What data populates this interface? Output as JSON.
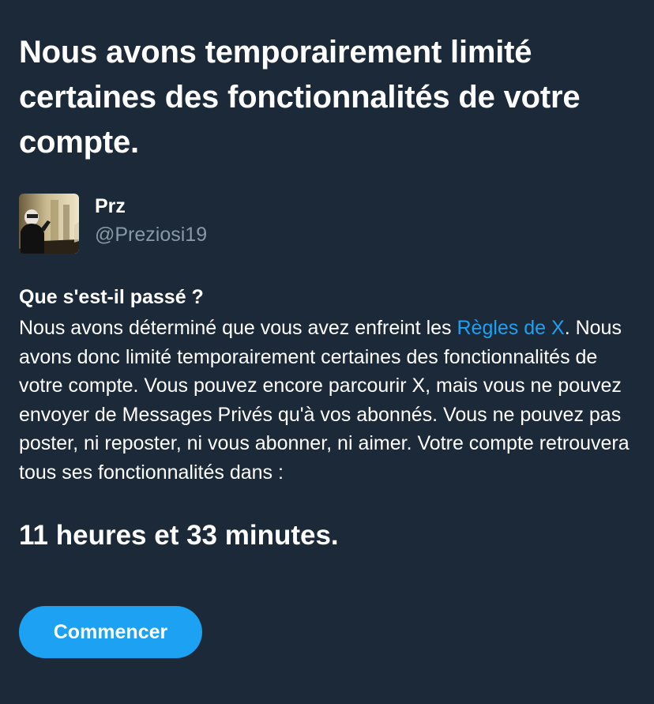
{
  "headline": "Nous avons temporairement limité certaines des fonctionnalités de votre compte.",
  "user": {
    "name": "Prz",
    "handle": "@Preziosi19",
    "avatar_icon": "profile-photo"
  },
  "section": {
    "title": "Que s'est-il passé ?",
    "body_before_link": "Nous avons déterminé que vous avez enfreint les ",
    "link_text": "Règles de X",
    "body_after_link": ". Nous avons donc limité temporairement certaines des fonctionnalités de votre compte. Vous pouvez encore parcourir X, mais vous ne pouvez envoyer de Messages Privés qu'à vos abonnés. Vous ne pouvez pas poster, ni reposter, ni vous abonner, ni aimer. Votre compte retrouvera tous ses fonctionnalités dans :"
  },
  "countdown": "11 heures et 33 minutes.",
  "button": {
    "label": "Commencer"
  },
  "colors": {
    "background": "#1c2938",
    "accent": "#1da1f2",
    "secondary_text": "#8899a6"
  }
}
